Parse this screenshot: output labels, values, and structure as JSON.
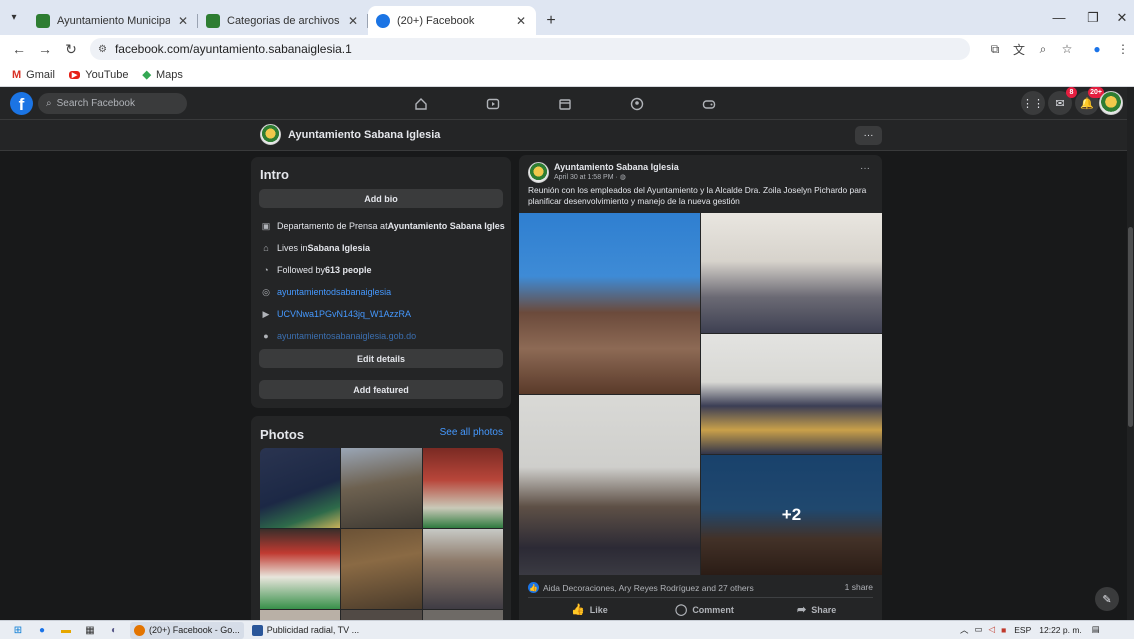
{
  "browser": {
    "tabs": [
      {
        "title": "Ayuntamiento Municipal de Sab",
        "favicon_color": "#2e7d32"
      },
      {
        "title": "Categorias de archivos Publicac",
        "favicon_color": "#2e7d32"
      },
      {
        "title": "(20+) Facebook",
        "favicon_color": "#1b74e4"
      }
    ],
    "url": "facebook.com/ayuntamiento.sabanaiglesia.1",
    "bookmarks": [
      {
        "label": "Gmail",
        "icon": "gmail-icon"
      },
      {
        "label": "YouTube",
        "icon": "youtube-icon"
      },
      {
        "label": "Maps",
        "icon": "maps-icon"
      }
    ]
  },
  "fb_header": {
    "search_placeholder": "Search Facebook",
    "messenger_badge": "8",
    "notifications_badge": "20+"
  },
  "page": {
    "name": "Ayuntamiento Sabana Iglesia",
    "more_label": "···"
  },
  "intro": {
    "title": "Intro",
    "add_bio": "Add bio",
    "work_prefix": "Departamento de Prensa at ",
    "work_org": "Ayuntamiento Sabana Iglesia",
    "lives_prefix": "Lives in ",
    "lives_place": "Sabana Iglesia",
    "followed_prefix": "Followed by ",
    "followed_count": "613 people",
    "instagram": "ayuntamientodsabanaiglesia",
    "youtube": "UCVNwa1PGvN143jq_W1AzzRA",
    "website": "ayuntamientosabanaiglesia.gob.do",
    "edit_details": "Edit details",
    "add_featured": "Add featured"
  },
  "photos": {
    "title": "Photos",
    "see_all": "See all photos"
  },
  "post": {
    "author": "Ayuntamiento Sabana Iglesia",
    "date": "April 30 at 1:58 PM · ",
    "more": "···",
    "text": "Reunión con los empleados del Ayuntamiento y la Alcalde Dra. Zoila Joselyn Pichardo para planificar desenvolvimiento y manejo de la nueva gestión",
    "more_photos": "+2",
    "reactions": "Aida Decoraciones, Ary Reyes Rodríguez and 27 others",
    "shares": "1 share",
    "like": "Like",
    "comment": "Comment",
    "share": "Share"
  },
  "taskbar": {
    "apps": [
      {
        "label": "(20+) Facebook - Go...",
        "icon_color": "#e37400"
      },
      {
        "label": "Publicidad radial, TV ...",
        "icon_color": "#2b579a"
      }
    ],
    "lang": "ESP",
    "time": "12:22 p. m."
  }
}
